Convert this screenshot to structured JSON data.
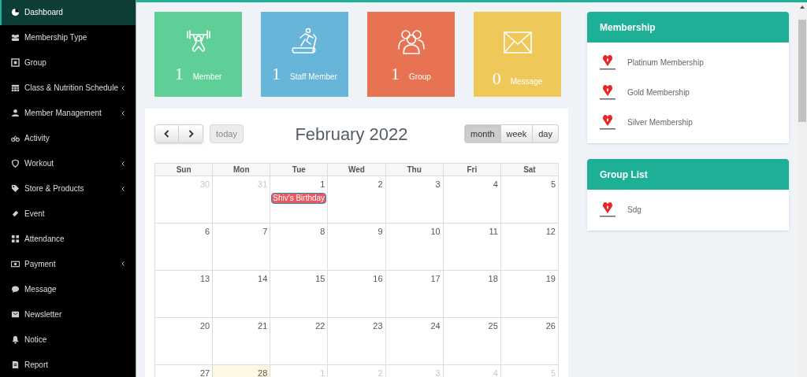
{
  "sidebar": {
    "items": [
      {
        "label": "Dashboard",
        "selected": true,
        "has_submenu": false
      },
      {
        "label": "Membership Type",
        "selected": false,
        "has_submenu": false
      },
      {
        "label": "Group",
        "selected": false,
        "has_submenu": false
      },
      {
        "label": "Class & Nutrition Schedule",
        "selected": false,
        "has_submenu": true
      },
      {
        "label": "Member Management",
        "selected": false,
        "has_submenu": true
      },
      {
        "label": "Activity",
        "selected": false,
        "has_submenu": false
      },
      {
        "label": "Workout",
        "selected": false,
        "has_submenu": true
      },
      {
        "label": "Store & Products",
        "selected": false,
        "has_submenu": true
      },
      {
        "label": "Event",
        "selected": false,
        "has_submenu": false
      },
      {
        "label": "Attendance",
        "selected": false,
        "has_submenu": false
      },
      {
        "label": "Payment",
        "selected": false,
        "has_submenu": true
      },
      {
        "label": "Message",
        "selected": false,
        "has_submenu": false
      },
      {
        "label": "Newsletter",
        "selected": false,
        "has_submenu": false
      },
      {
        "label": "Notice",
        "selected": false,
        "has_submenu": false
      },
      {
        "label": "Report",
        "selected": false,
        "has_submenu": false
      }
    ]
  },
  "stats": [
    {
      "count": "1",
      "label": "Member",
      "color": "#5fcf98"
    },
    {
      "count": "1",
      "label": "Staff Member",
      "color": "#67b5d8"
    },
    {
      "count": "1",
      "label": "Group",
      "color": "#e87352"
    },
    {
      "count": "0",
      "label": "Message",
      "color": "#eec95a"
    }
  ],
  "calendar": {
    "title": "February 2022",
    "today_button": {
      "label": "today",
      "disabled": true
    },
    "views": [
      {
        "label": "month",
        "selected": true
      },
      {
        "label": "week",
        "selected": false
      },
      {
        "label": "day",
        "selected": false
      }
    ],
    "weekdays": [
      "Sun",
      "Mon",
      "Tue",
      "Wed",
      "Thu",
      "Fri",
      "Sat"
    ],
    "weeks": [
      [
        {
          "day": "30",
          "other_month": true,
          "today": false
        },
        {
          "day": "31",
          "other_month": true,
          "today": false
        },
        {
          "day": "1",
          "other_month": false,
          "today": false,
          "events": [
            {
              "title": "Shiv's Birthday",
              "color": "#e9585e"
            }
          ]
        },
        {
          "day": "2",
          "other_month": false,
          "today": false
        },
        {
          "day": "3",
          "other_month": false,
          "today": false
        },
        {
          "day": "4",
          "other_month": false,
          "today": false
        },
        {
          "day": "5",
          "other_month": false,
          "today": false
        }
      ],
      [
        {
          "day": "6",
          "other_month": false,
          "today": false
        },
        {
          "day": "7",
          "other_month": false,
          "today": false
        },
        {
          "day": "8",
          "other_month": false,
          "today": false
        },
        {
          "day": "9",
          "other_month": false,
          "today": false
        },
        {
          "day": "10",
          "other_month": false,
          "today": false
        },
        {
          "day": "11",
          "other_month": false,
          "today": false
        },
        {
          "day": "12",
          "other_month": false,
          "today": false
        }
      ],
      [
        {
          "day": "13",
          "other_month": false,
          "today": false
        },
        {
          "day": "14",
          "other_month": false,
          "today": false
        },
        {
          "day": "15",
          "other_month": false,
          "today": false
        },
        {
          "day": "16",
          "other_month": false,
          "today": false
        },
        {
          "day": "17",
          "other_month": false,
          "today": false
        },
        {
          "day": "18",
          "other_month": false,
          "today": false
        },
        {
          "day": "19",
          "other_month": false,
          "today": false
        }
      ],
      [
        {
          "day": "20",
          "other_month": false,
          "today": false
        },
        {
          "day": "21",
          "other_month": false,
          "today": false
        },
        {
          "day": "22",
          "other_month": false,
          "today": false
        },
        {
          "day": "23",
          "other_month": false,
          "today": false
        },
        {
          "day": "24",
          "other_month": false,
          "today": false
        },
        {
          "day": "25",
          "other_month": false,
          "today": false
        },
        {
          "day": "26",
          "other_month": false,
          "today": false
        }
      ],
      [
        {
          "day": "27",
          "other_month": false,
          "today": false
        },
        {
          "day": "28",
          "other_month": false,
          "today": true
        },
        {
          "day": "1",
          "other_month": true,
          "today": false
        },
        {
          "day": "2",
          "other_month": true,
          "today": false
        },
        {
          "day": "3",
          "other_month": true,
          "today": false
        },
        {
          "day": "4",
          "other_month": true,
          "today": false
        },
        {
          "day": "5",
          "other_month": true,
          "today": false
        }
      ]
    ]
  },
  "panels": [
    {
      "title": "Membership",
      "items": [
        {
          "name": "Platinum Membership"
        },
        {
          "name": "Gold Membership"
        },
        {
          "name": "Silver Membership"
        }
      ]
    },
    {
      "title": "Group List",
      "items": [
        {
          "name": "Sdg"
        }
      ]
    }
  ]
}
